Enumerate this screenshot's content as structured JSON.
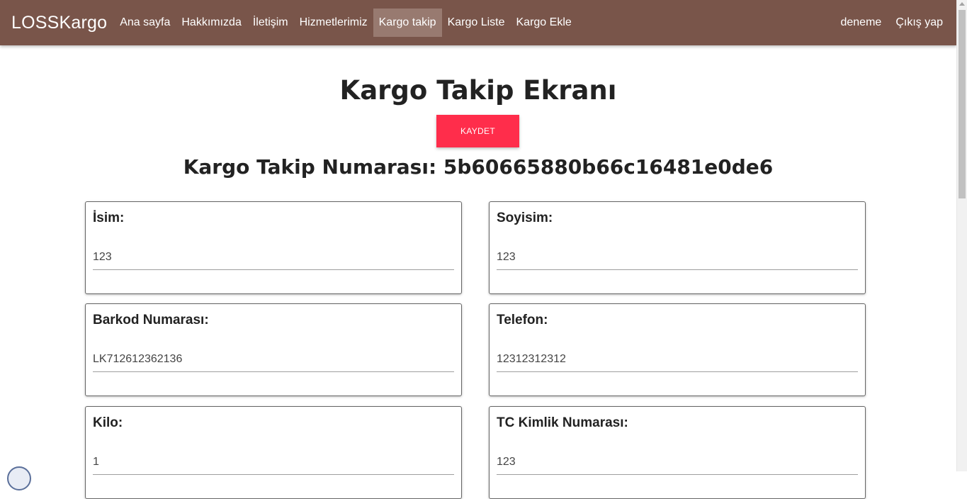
{
  "nav": {
    "brand": "LOSSKargo",
    "items": [
      {
        "label": "Ana sayfa",
        "active": false
      },
      {
        "label": "Hakkımızda",
        "active": false
      },
      {
        "label": "İletişim",
        "active": false
      },
      {
        "label": "Hizmetlerimiz",
        "active": false
      },
      {
        "label": "Kargo takip",
        "active": true
      },
      {
        "label": "Kargo Liste",
        "active": false
      },
      {
        "label": "Kargo Ekle",
        "active": false
      }
    ],
    "user": "deneme",
    "logout": "Çıkış yap"
  },
  "main": {
    "title": "Kargo Takip Ekranı",
    "save_label": "KAYDET",
    "tracking_label": "Kargo Takip Numarası:",
    "tracking_number": "5b60665880b66c16481e0de6",
    "tracking_full": "Kargo Takip Numarası: 5b60665880b66c16481e0de6"
  },
  "fields": {
    "name": {
      "label": "İsim:",
      "value": "123"
    },
    "surname": {
      "label": "Soyisim:",
      "value": "123"
    },
    "barcode": {
      "label": "Barkod Numarası:",
      "value": "LK712612362136"
    },
    "phone": {
      "label": "Telefon:",
      "value": "12312312312"
    },
    "weight": {
      "label": "Kilo:",
      "value": "1"
    },
    "tc": {
      "label": "TC Kimlik Numarası:",
      "value": "123"
    }
  },
  "colors": {
    "navbar": "#79554a",
    "active_nav": "#987a70",
    "save_button": "#ff2d4b"
  }
}
